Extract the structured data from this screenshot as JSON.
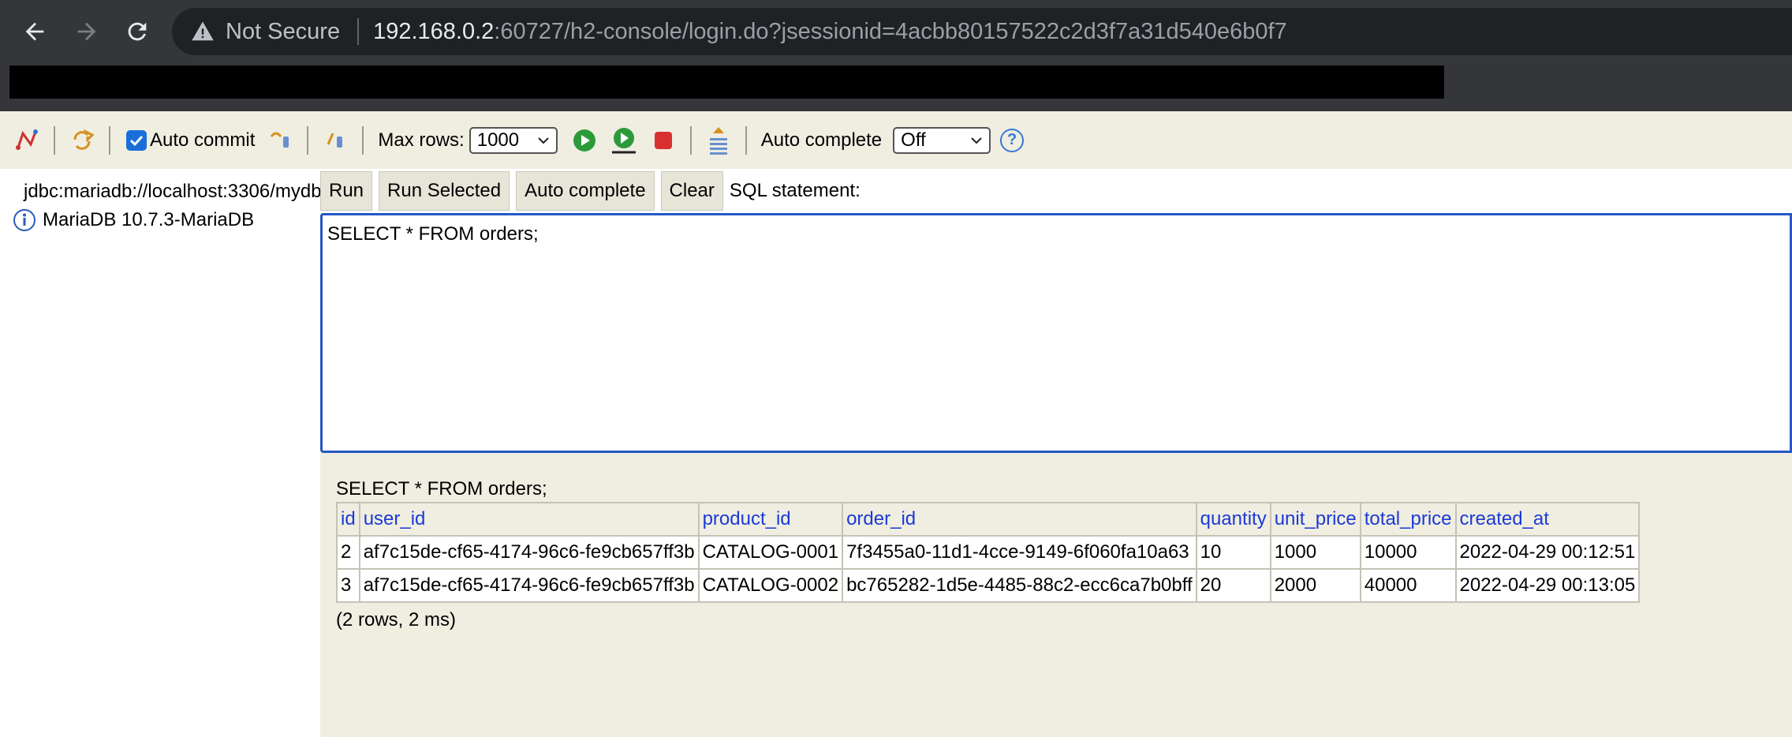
{
  "browser": {
    "security_label": "Not Secure",
    "url_host": "192.168.0.2",
    "url_rest": ":60727/h2-console/login.do?jsessionid=4acbb80157522c2d3f7a31d540e6b0f7"
  },
  "toolbar": {
    "auto_commit_label": "Auto commit",
    "max_rows_label": "Max rows:",
    "max_rows_value": "1000",
    "auto_complete_label": "Auto complete",
    "auto_complete_value": "Off",
    "help_glyph": "?"
  },
  "tree": {
    "connection": "jdbc:mariadb://localhost:3306/mydb",
    "version": "MariaDB 10.7.3-MariaDB"
  },
  "query_bar": {
    "run": "Run",
    "run_selected": "Run Selected",
    "auto_complete": "Auto complete",
    "clear": "Clear",
    "sql_label": "SQL statement:"
  },
  "editor": {
    "sql": "SELECT * FROM orders;"
  },
  "result": {
    "title": "SELECT * FROM orders;",
    "columns": [
      "id",
      "user_id",
      "product_id",
      "order_id",
      "quantity",
      "unit_price",
      "total_price",
      "created_at"
    ],
    "rows": [
      [
        "2",
        "af7c15de-cf65-4174-96c6-fe9cb657ff3b",
        "CATALOG-0001",
        "7f3455a0-11d1-4cce-9149-6f060fa10a63",
        "10",
        "1000",
        "10000",
        "2022-04-29 00:12:51"
      ],
      [
        "3",
        "af7c15de-cf65-4174-96c6-fe9cb657ff3b",
        "CATALOG-0002",
        "bc765282-1d5e-4485-88c2-ecc6ca7b0bff",
        "20",
        "2000",
        "40000",
        "2022-04-29 00:13:05"
      ]
    ],
    "footer": "(2 rows, 2 ms)"
  },
  "colors": {
    "chrome_bg": "#35363a",
    "h2_bg": "#efeee1",
    "link_blue": "#1c3ad6",
    "editor_border": "#2458c4"
  }
}
